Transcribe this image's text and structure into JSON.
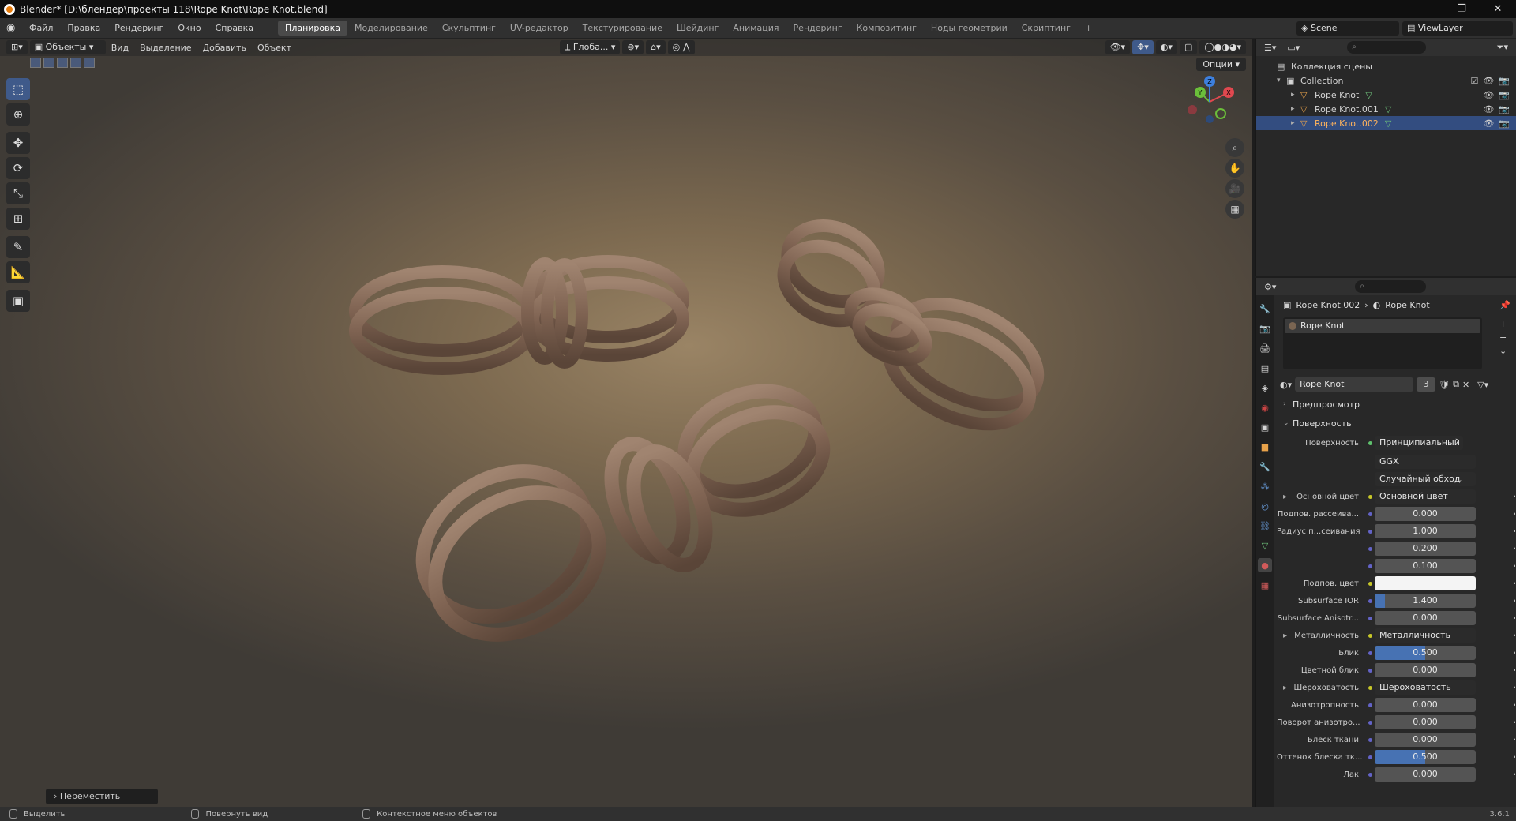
{
  "window": {
    "title": "Blender* [D:\\блендер\\проекты 118\\Rope Knot\\Rope Knot.blend]",
    "minimize": "–",
    "maximize": "❐",
    "close": "✕"
  },
  "menu": {
    "items": [
      "Файл",
      "Правка",
      "Рендеринг",
      "Окно",
      "Справка"
    ]
  },
  "workspaces": [
    "Планировка",
    "Моделирование",
    "Скульптинг",
    "UV-редактор",
    "Текстурирование",
    "Шейдинг",
    "Анимация",
    "Рендеринг",
    "Композитинг",
    "Ноды геометрии",
    "Скриптинг"
  ],
  "active_workspace": "Планировка",
  "scene": {
    "name": "Scene",
    "view_layer": "ViewLayer"
  },
  "viewport": {
    "mode": "Объекты",
    "menu": [
      "Вид",
      "Выделение",
      "Добавить",
      "Объект"
    ],
    "transform_orientation": "Глоба...",
    "options": "Опции",
    "gizmo_axes": {
      "x": "X",
      "y": "Y",
      "z": "Z"
    },
    "last_operator": "Переместить"
  },
  "outliner": {
    "scene_collection": "Коллекция сцены",
    "collection": "Collection",
    "objects": [
      {
        "name": "Rope Knot",
        "selected": false
      },
      {
        "name": "Rope Knot.001",
        "selected": false
      },
      {
        "name": "Rope Knot.002",
        "selected": true
      }
    ]
  },
  "properties": {
    "breadcrumb_object": "Rope Knot.002",
    "breadcrumb_material": "Rope Knot",
    "material_slot": "Rope Knot",
    "material_name": "Rope Knot",
    "material_users": "3",
    "sections": {
      "preview": "Предпросмотр",
      "surface": "Поверхность"
    },
    "surface_label": "Поверхность",
    "surface_value": "Принципиальный BSDF",
    "distribution": "GGX",
    "subsurface_method": "Случайный обход",
    "rows": [
      {
        "label": "Основной цвет",
        "value": "Основной цвет",
        "kind": "link",
        "arrow": true
      },
      {
        "label": "Подпов. рассеива...",
        "value": "0.000",
        "kind": "num",
        "fill": 0
      },
      {
        "label": "Радиус п...сеивания",
        "value": "1.000",
        "kind": "num",
        "fill": 0
      },
      {
        "label": "",
        "value": "0.200",
        "kind": "num",
        "fill": 0
      },
      {
        "label": "",
        "value": "0.100",
        "kind": "num",
        "fill": 0
      },
      {
        "label": "Подпов. цвет",
        "value": "",
        "kind": "color"
      },
      {
        "label": "Subsurface IOR",
        "value": "1.400",
        "kind": "num",
        "fill": 0.1
      },
      {
        "label": "Subsurface Anisotr...",
        "value": "0.000",
        "kind": "num",
        "fill": 0
      },
      {
        "label": "Металличность",
        "value": "Металличность",
        "kind": "link",
        "arrow": true
      },
      {
        "label": "Блик",
        "value": "0.500",
        "kind": "num",
        "fill": 0.5
      },
      {
        "label": "Цветной блик",
        "value": "0.000",
        "kind": "num",
        "fill": 0
      },
      {
        "label": "Шероховатость",
        "value": "Шероховатость",
        "kind": "link",
        "arrow": true
      },
      {
        "label": "Анизотропность",
        "value": "0.000",
        "kind": "num",
        "fill": 0
      },
      {
        "label": "Поворот анизотро...",
        "value": "0.000",
        "kind": "num",
        "fill": 0
      },
      {
        "label": "Блеск ткани",
        "value": "0.000",
        "kind": "num",
        "fill": 0
      },
      {
        "label": "Оттенок блеска тк...",
        "value": "0.500",
        "kind": "num",
        "fill": 0.5
      },
      {
        "label": "Лак",
        "value": "0.000",
        "kind": "num",
        "fill": 0
      }
    ]
  },
  "statusbar": {
    "select": "Выделить",
    "rotate": "Повернуть вид",
    "context": "Контекстное меню объектов",
    "version": "3.6.1"
  }
}
